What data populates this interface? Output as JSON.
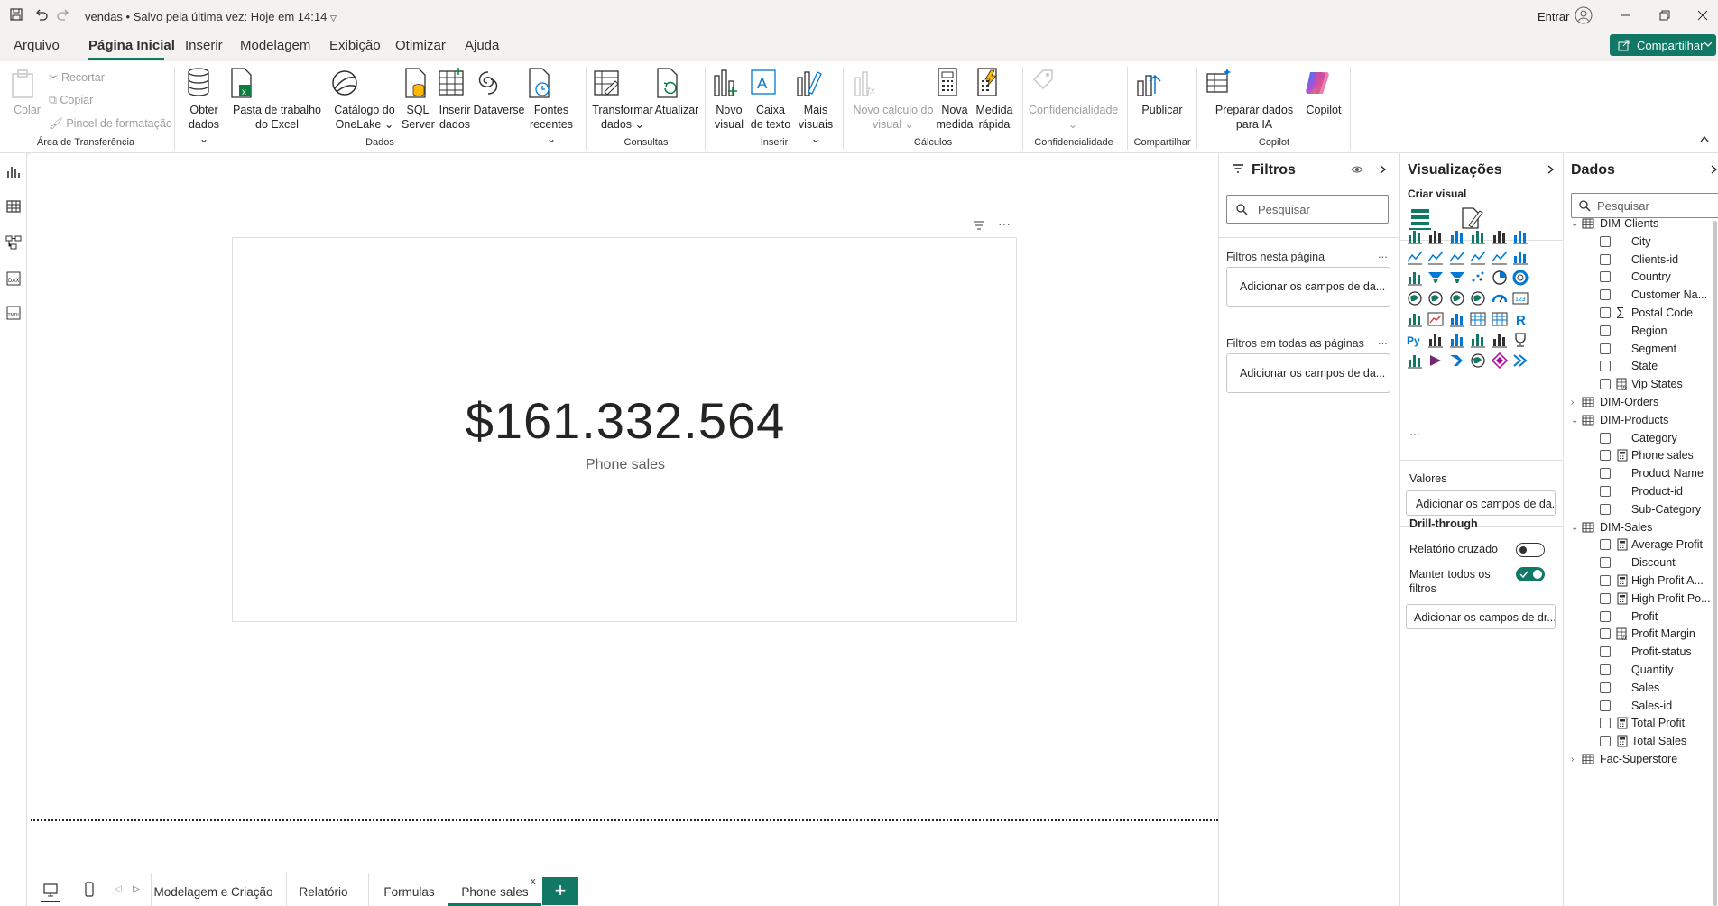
{
  "titlebar": {
    "title": "vendas • Salvo pela última vez: Hoje em 14:14",
    "signin": "Entrar"
  },
  "menu": {
    "items": [
      "Arquivo",
      "Página Inicial",
      "Inserir",
      "Modelagem",
      "Exibição",
      "Otimizar",
      "Ajuda"
    ],
    "active": "Página Inicial",
    "share": "Compartilhar"
  },
  "ribbon": {
    "clipboard": {
      "paste": "Colar",
      "cut": "Recortar",
      "copy": "Copiar",
      "format_painter": "Pincel de formatação",
      "group": "Área de Transferência"
    },
    "data": {
      "get_data": "Obter dados",
      "excel": "Pasta de trabalho do Excel",
      "onelake": "Catálogo do OneLake",
      "sql": "SQL Server",
      "enter_data": "Inserir dados",
      "dataverse": "Dataverse",
      "recent": "Fontes recentes",
      "group": "Dados"
    },
    "queries": {
      "transform": "Transformar dados",
      "refresh": "Atualizar",
      "group": "Consultas"
    },
    "insert": {
      "new_visual": "Novo visual",
      "text_box": "Caixa de texto",
      "more_visuals": "Mais visuais",
      "group": "Inserir"
    },
    "calculations": {
      "new_calc": "Novo cálculo do visual",
      "new_measure": "Nova medida",
      "quick_measure": "Medida rápida",
      "group": "Cálculos"
    },
    "sensitivity": {
      "label": "Confidencialidade",
      "group": "Confidencialidade"
    },
    "share": {
      "publish": "Publicar",
      "group": "Compartilhar"
    },
    "copilot": {
      "prep": "Preparar dados para IA",
      "copilot": "Copilot",
      "group": "Copilot"
    }
  },
  "card": {
    "value": "$161.332.564",
    "label": "Phone sales"
  },
  "pages": {
    "tabs": [
      "Modelagem e Criação",
      "Relatório",
      "Formulas",
      "Phone sales"
    ],
    "active": "Phone sales",
    "close": "x",
    "add": "+"
  },
  "filters": {
    "title": "Filtros",
    "search_placeholder": "Pesquisar",
    "on_page": "Filtros nesta página",
    "on_all": "Filtros em todas as páginas",
    "add_fields": "Adicionar os campos de da...",
    "more": "..."
  },
  "visualizations": {
    "title": "Visualizações",
    "build": "Criar visual",
    "values": "Valores",
    "add_fields": "Adicionar os campos de da...",
    "drill_through": "Drill-through",
    "cross_report": "Relatório cruzado",
    "cross_report_on": false,
    "keep_filters": "Manter todos os filtros",
    "keep_filters_on": true,
    "drill_add": "Adicionar os campos de dr...",
    "more": "...",
    "icons": [
      "stacked-bar-chart-icon",
      "clustered-column-chart-icon",
      "clustered-bar-chart-icon",
      "stacked-column-chart-icon",
      "100-bar-chart-icon",
      "100-column-chart-icon",
      "line-chart-icon",
      "area-chart-icon",
      "stacked-area-chart-icon",
      "line-area-icon",
      "line-column-chart-icon",
      "ribbon-chart-icon",
      "waterfall-chart-icon",
      "funnel-icon",
      "funnel-chart-icon",
      "scatter-chart-icon",
      "pie-chart-icon",
      "donut-chart-icon",
      "treemap-icon",
      "map-icon",
      "filled-map-icon",
      "azure-map-icon",
      "gauge-icon",
      "card-icon",
      "multi-row-card-icon",
      "kpi-icon",
      "slicer-icon",
      "table-icon",
      "matrix-icon",
      "r-visual-icon",
      "python-visual-icon",
      "key-influencers-icon",
      "decomposition-tree-icon",
      "qa-icon",
      "narrative-icon",
      "metrics-icon",
      "paginated-report-icon",
      "powerapps-icon",
      "power-automate-icon",
      "shape-map-icon",
      "diamond-visual-icon",
      "chevron-visual-icon"
    ],
    "r_text": "R",
    "py_text": "Py"
  },
  "data_pane": {
    "title": "Dados",
    "search_placeholder": "Pesquisar",
    "tree": [
      {
        "type": "table",
        "label": "DIM-Clients",
        "expanded": true
      },
      {
        "type": "field",
        "label": "City",
        "icon": ""
      },
      {
        "type": "field",
        "label": "Clients-id",
        "icon": ""
      },
      {
        "type": "field",
        "label": "Country",
        "icon": ""
      },
      {
        "type": "field",
        "label": "Customer Na...",
        "icon": ""
      },
      {
        "type": "field",
        "label": "Postal Code",
        "icon": "sigma"
      },
      {
        "type": "field",
        "label": "Region",
        "icon": ""
      },
      {
        "type": "field",
        "label": "Segment",
        "icon": ""
      },
      {
        "type": "field",
        "label": "State",
        "icon": ""
      },
      {
        "type": "field",
        "label": "Vip States",
        "icon": "calc"
      },
      {
        "type": "table",
        "label": "DIM-Orders",
        "expanded": false
      },
      {
        "type": "table",
        "label": "DIM-Products",
        "expanded": true
      },
      {
        "type": "field",
        "label": "Category",
        "icon": ""
      },
      {
        "type": "field",
        "label": "Phone sales",
        "icon": "measure"
      },
      {
        "type": "field",
        "label": "Product Name",
        "icon": ""
      },
      {
        "type": "field",
        "label": "Product-id",
        "icon": ""
      },
      {
        "type": "field",
        "label": "Sub-Category",
        "icon": ""
      },
      {
        "type": "table",
        "label": "DIM-Sales",
        "expanded": true
      },
      {
        "type": "field",
        "label": "Average Profit",
        "icon": "measure"
      },
      {
        "type": "field",
        "label": "Discount",
        "icon": ""
      },
      {
        "type": "field",
        "label": "High Profit A...",
        "icon": "measure"
      },
      {
        "type": "field",
        "label": "High Profit Po...",
        "icon": "measure"
      },
      {
        "type": "field",
        "label": "Profit",
        "icon": ""
      },
      {
        "type": "field",
        "label": "Profit Margin",
        "icon": "calc"
      },
      {
        "type": "field",
        "label": "Profit-status",
        "icon": ""
      },
      {
        "type": "field",
        "label": "Quantity",
        "icon": ""
      },
      {
        "type": "field",
        "label": "Sales",
        "icon": ""
      },
      {
        "type": "field",
        "label": "Sales-id",
        "icon": ""
      },
      {
        "type": "field",
        "label": "Total Profit",
        "icon": "measure"
      },
      {
        "type": "field",
        "label": "Total Sales",
        "icon": "measure"
      },
      {
        "type": "table",
        "label": "Fac-Superstore",
        "expanded": false
      }
    ]
  },
  "colors": {
    "accent": "#117865",
    "ribbon_bg": "#f3f2f1",
    "border": "#e1dfdd"
  }
}
